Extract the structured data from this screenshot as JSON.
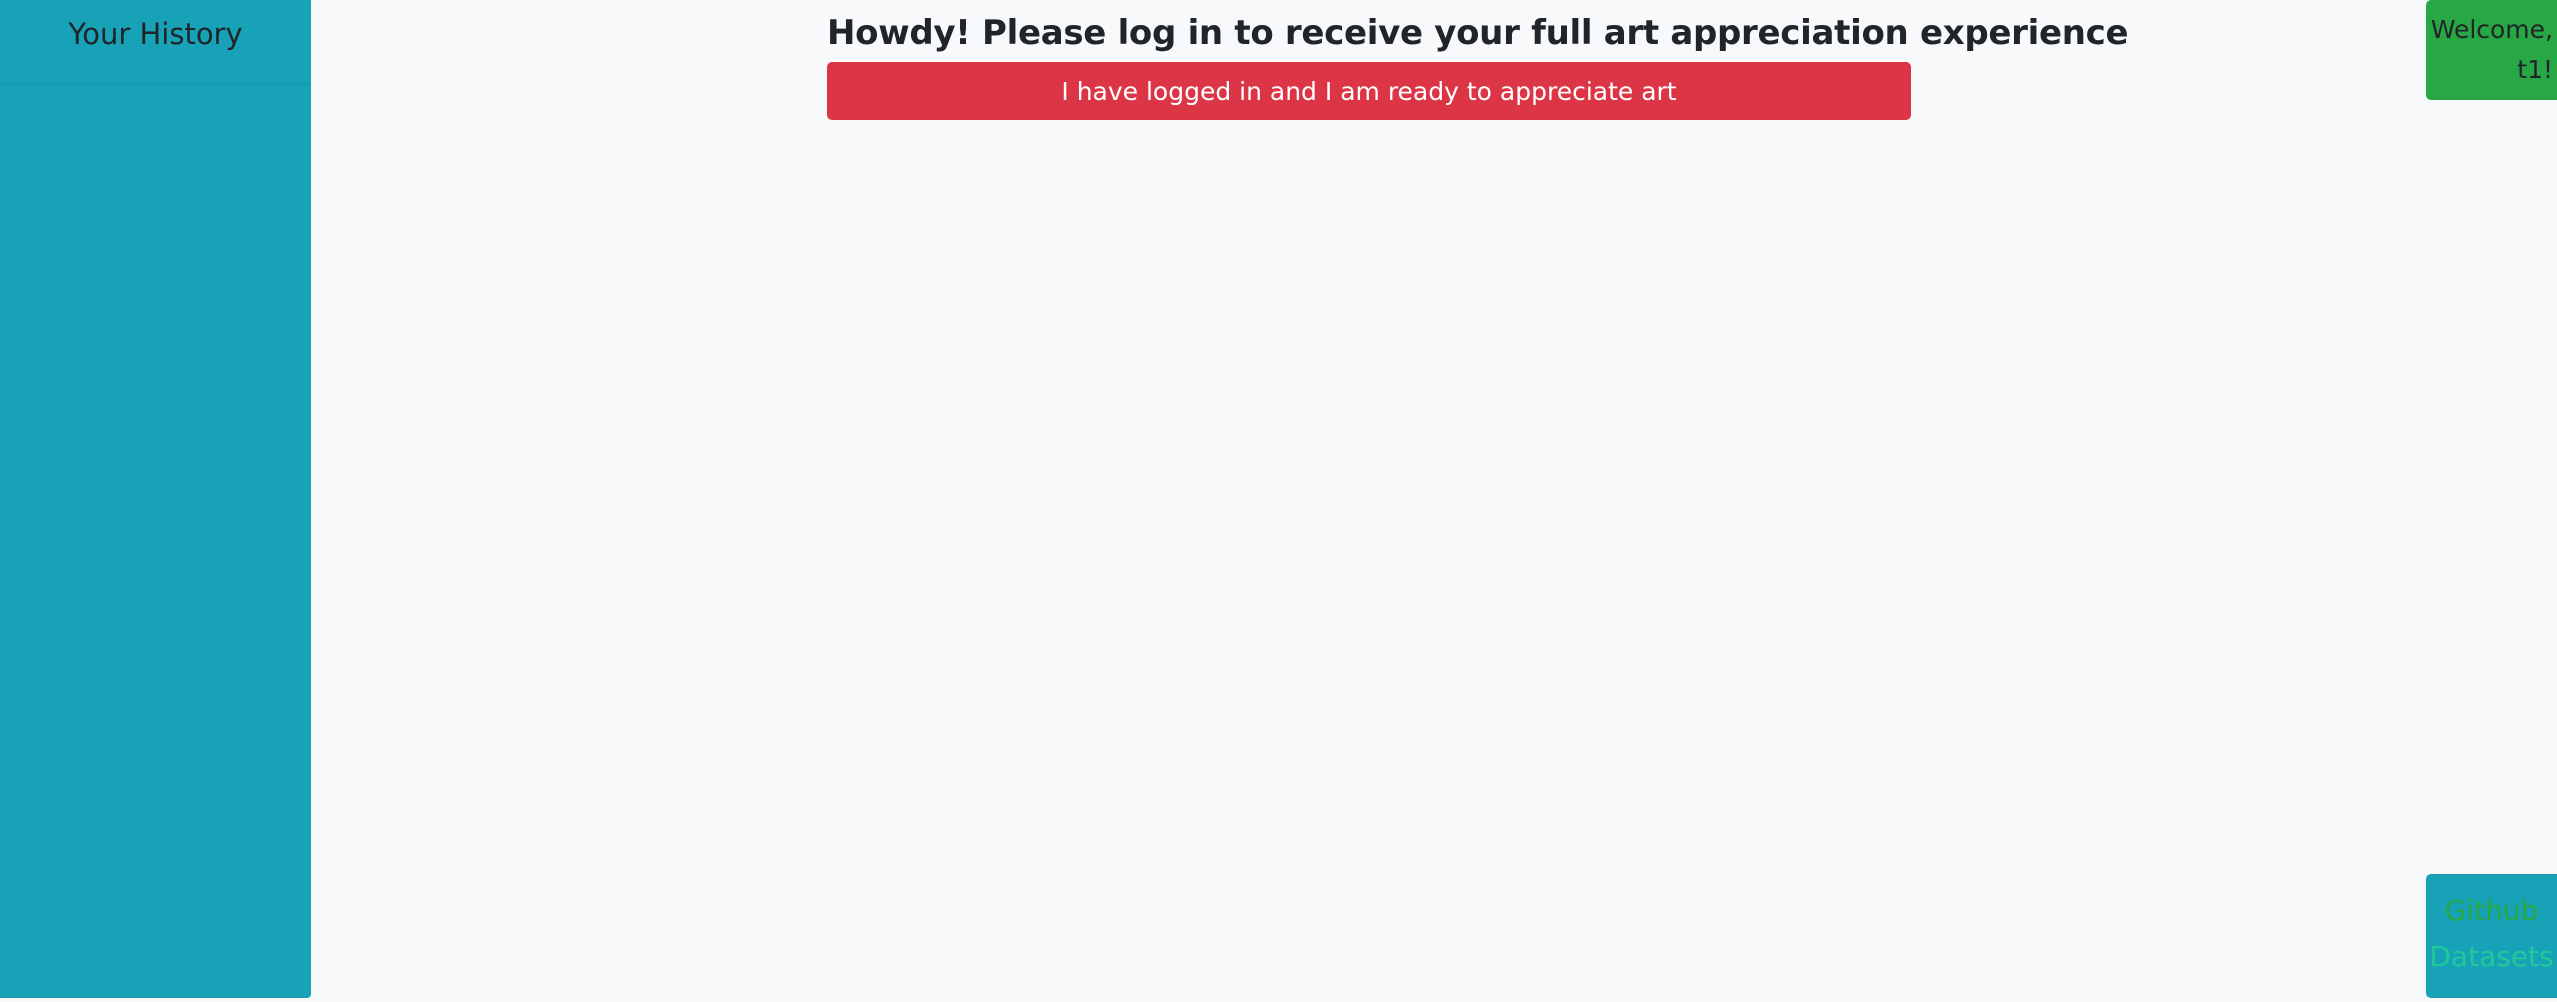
{
  "sidebar": {
    "title": "Your History"
  },
  "main": {
    "heading": "Howdy! Please log in to receive your full art appreciation experience",
    "login_button_label": "I have logged in and I am ready to appreciate art"
  },
  "user": {
    "welcome_text": "Welcome, t1!"
  },
  "links": {
    "github_label": "Github",
    "datasets_label": "Datasets"
  },
  "colors": {
    "background": "#f8f9fa",
    "sidebar": "#17a2b8",
    "login_button": "#dc3545",
    "welcome_box": "#28a745",
    "github_link": "#28a745",
    "datasets_link": "#20c997"
  }
}
